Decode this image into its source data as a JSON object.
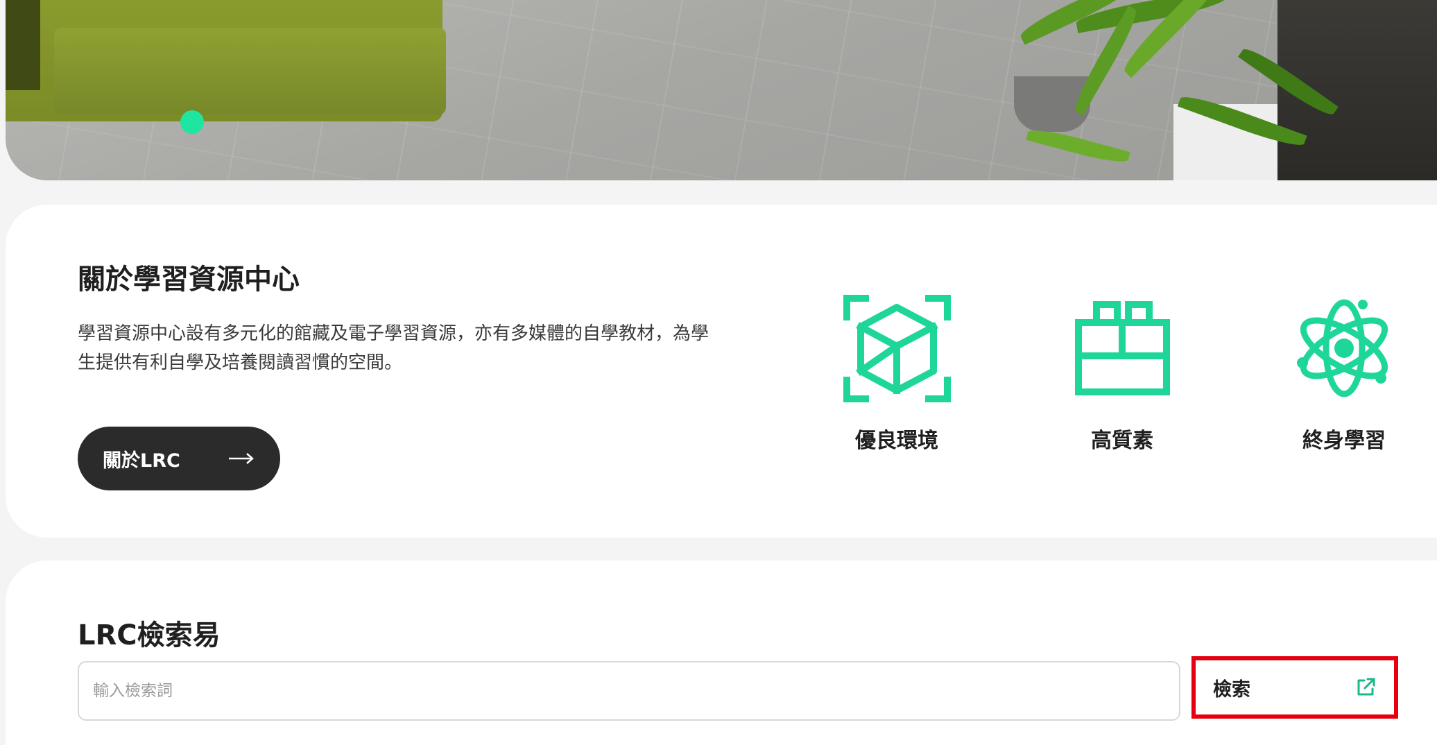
{
  "hero": {
    "carousel_dot_color": "#1ee6a0"
  },
  "about": {
    "title": "關於學習資源中心",
    "description_line1": "學習資源中心設有多元化的館藏及電子學習資源，亦有多媒體的自學教材，為學",
    "description_line2": "生提供有利自學及培養閱讀習慣的空間。",
    "button_label": "關於LRC",
    "features": [
      {
        "label": "優良環境",
        "icon": "cube-icon"
      },
      {
        "label": "高質素",
        "icon": "building-blocks-icon"
      },
      {
        "label": "終身學習",
        "icon": "atom-icon"
      }
    ],
    "accent_color": "#1ed69a"
  },
  "search": {
    "title": "LRC檢索易",
    "placeholder": "輸入檢索詞",
    "button_label": "檢索",
    "highlight_color": "#e6000f"
  }
}
